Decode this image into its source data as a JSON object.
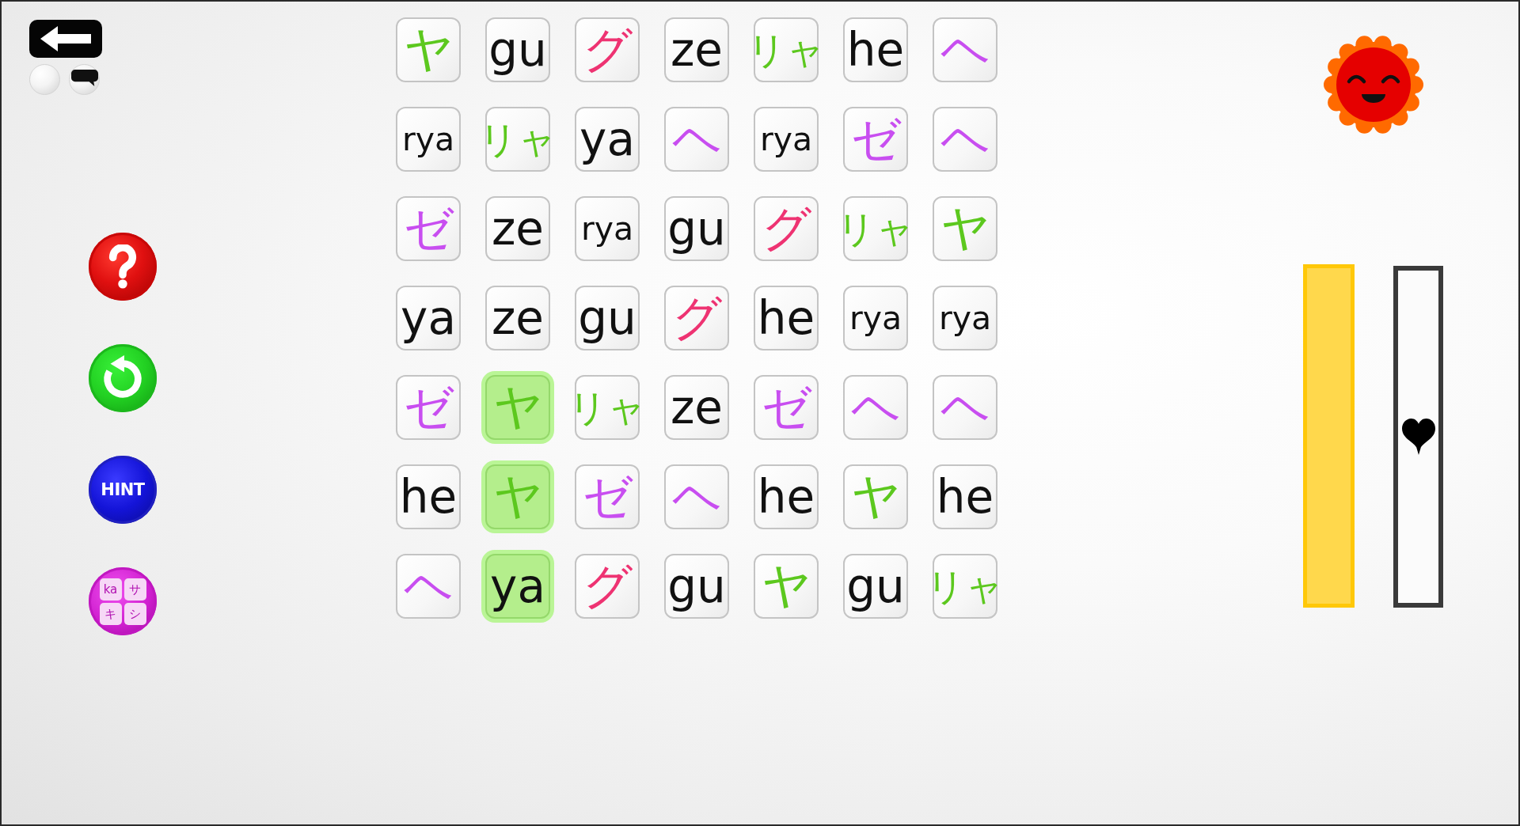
{
  "side_buttons": [
    {
      "kind": "help"
    },
    {
      "kind": "restart"
    },
    {
      "kind": "hint",
      "label": "HINT"
    },
    {
      "kind": "kana_chart",
      "labels": [
        "ka",
        "サ",
        "キ",
        "シ"
      ]
    }
  ],
  "grid": {
    "rows": [
      {
        "tiles": [
          {
            "text": "ヤ",
            "color": "#5cc81e",
            "selected": false
          },
          {
            "text": "gu",
            "color": "#111111",
            "selected": false
          },
          {
            "text": "グ",
            "color": "#ee3372",
            "selected": false
          },
          {
            "text": "ze",
            "color": "#111111",
            "selected": false
          },
          {
            "text": "リャ",
            "color": "#5cc81e",
            "selected": false
          },
          {
            "text": "he",
            "color": "#111111",
            "selected": false
          },
          {
            "text": "ヘ",
            "color": "#c84ef0",
            "selected": false
          }
        ]
      },
      {
        "tiles": [
          {
            "text": "rya",
            "color": "#111111",
            "selected": false
          },
          {
            "text": "リャ",
            "color": "#5cc81e",
            "selected": false
          },
          {
            "text": "ya",
            "color": "#111111",
            "selected": false
          },
          {
            "text": "ヘ",
            "color": "#c84ef0",
            "selected": false
          },
          {
            "text": "rya",
            "color": "#111111",
            "selected": false
          },
          {
            "text": "ゼ",
            "color": "#c84ef0",
            "selected": false
          },
          {
            "text": "ヘ",
            "color": "#c84ef0",
            "selected": false
          }
        ]
      },
      {
        "tiles": [
          {
            "text": "ゼ",
            "color": "#c84ef0",
            "selected": false
          },
          {
            "text": "ze",
            "color": "#111111",
            "selected": false
          },
          {
            "text": "rya",
            "color": "#111111",
            "selected": false
          },
          {
            "text": "gu",
            "color": "#111111",
            "selected": false
          },
          {
            "text": "グ",
            "color": "#ee3372",
            "selected": false
          },
          {
            "text": "リャ",
            "color": "#5cc81e",
            "selected": false
          },
          {
            "text": "ヤ",
            "color": "#5cc81e",
            "selected": false
          }
        ]
      },
      {
        "tiles": [
          {
            "text": "ya",
            "color": "#111111",
            "selected": false
          },
          {
            "text": "ze",
            "color": "#111111",
            "selected": false
          },
          {
            "text": "gu",
            "color": "#111111",
            "selected": false
          },
          {
            "text": "グ",
            "color": "#ee3372",
            "selected": false
          },
          {
            "text": "he",
            "color": "#111111",
            "selected": false
          },
          {
            "text": "rya",
            "color": "#111111",
            "selected": false
          },
          {
            "text": "rya",
            "color": "#111111",
            "selected": false
          }
        ]
      },
      {
        "tiles": [
          {
            "text": "ゼ",
            "color": "#c84ef0",
            "selected": false
          },
          {
            "text": "ヤ",
            "color": "#5cc81e",
            "selected": true
          },
          {
            "text": "リャ",
            "color": "#5cc81e",
            "selected": false
          },
          {
            "text": "ze",
            "color": "#111111",
            "selected": false
          },
          {
            "text": "ゼ",
            "color": "#c84ef0",
            "selected": false
          },
          {
            "text": "ヘ",
            "color": "#c84ef0",
            "selected": false
          },
          {
            "text": "ヘ",
            "color": "#c84ef0",
            "selected": false
          }
        ]
      },
      {
        "tiles": [
          {
            "text": "he",
            "color": "#111111",
            "selected": false
          },
          {
            "text": "ヤ",
            "color": "#5cc81e",
            "selected": true
          },
          {
            "text": "ゼ",
            "color": "#c84ef0",
            "selected": false
          },
          {
            "text": "ヘ",
            "color": "#c84ef0",
            "selected": false
          },
          {
            "text": "he",
            "color": "#111111",
            "selected": false
          },
          {
            "text": "ヤ",
            "color": "#5cc81e",
            "selected": false
          },
          {
            "text": "he",
            "color": "#111111",
            "selected": false
          }
        ]
      },
      {
        "tiles": [
          {
            "text": "ヘ",
            "color": "#c84ef0",
            "selected": false
          },
          {
            "text": "ya",
            "color": "#111111",
            "selected": true
          },
          {
            "text": "グ",
            "color": "#ee3372",
            "selected": false
          },
          {
            "text": "gu",
            "color": "#111111",
            "selected": false
          },
          {
            "text": "ヤ",
            "color": "#5cc81e",
            "selected": false
          },
          {
            "text": "gu",
            "color": "#111111",
            "selected": false
          },
          {
            "text": "リャ",
            "color": "#5cc81e",
            "selected": false
          }
        ]
      }
    ]
  },
  "gauges": [
    {
      "kind": "bar",
      "level": 1
    },
    {
      "kind": "heart",
      "level": 0.5
    }
  ]
}
